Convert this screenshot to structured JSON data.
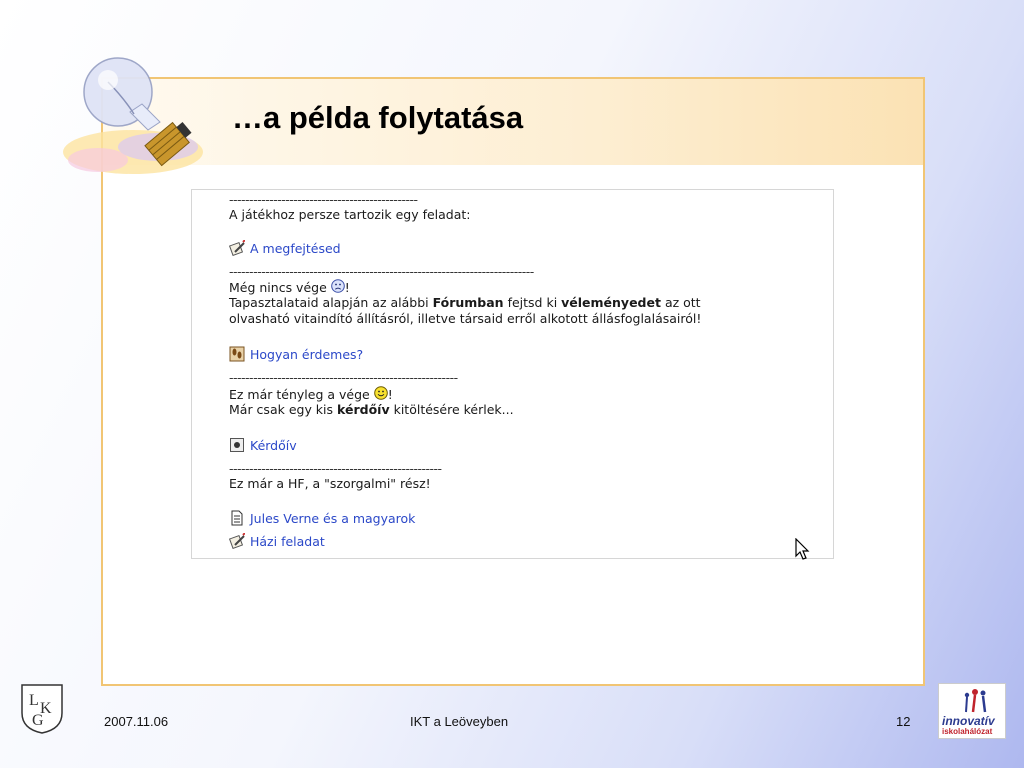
{
  "slide": {
    "title": "…a példa folytatása"
  },
  "content": {
    "sep1": "-----------------------------------------------",
    "line1": "A játékhoz persze tartozik egy feladat:",
    "link1": "A megfejtésed",
    "sep2": "----------------------------------------------------------------------------",
    "line2a": "Még nincs vége ",
    "line2b": "!",
    "line3_pre": "Tapasztalataid alapján az alábbi ",
    "line3_b1": "Fórumban",
    "line3_mid": " fejtsd ki ",
    "line3_b2": "véleményedet",
    "line3_post": " az ott",
    "line4": "olvasható vitaindító állításról, illetve társaid erről alkotott állásfoglalásairól!",
    "link2": "Hogyan érdemes?",
    "sep3": "---------------------------------------------------------",
    "line5a": "Ez már tényleg a vége ",
    "line5b": "!",
    "line6_pre": "Már csak egy kis ",
    "line6_b": "kérdőív",
    "line6_post": " kitöltésére kérlek...",
    "link3": "Kérdőív",
    "sep4": "-----------------------------------------------------",
    "line7": "Ez már a HF, a \"szorgalmi\" rész!",
    "link4": "Jules Verne és a magyarok",
    "link5": "Házi feladat"
  },
  "footer": {
    "date": "2007.11.06",
    "center": "IKT a Leöveyben",
    "page": "12",
    "logo_right_line1": "innovatív",
    "logo_right_line2": "iskolahálózat"
  },
  "colors": {
    "link": "#2b48c8",
    "frame": "#f1c574"
  }
}
